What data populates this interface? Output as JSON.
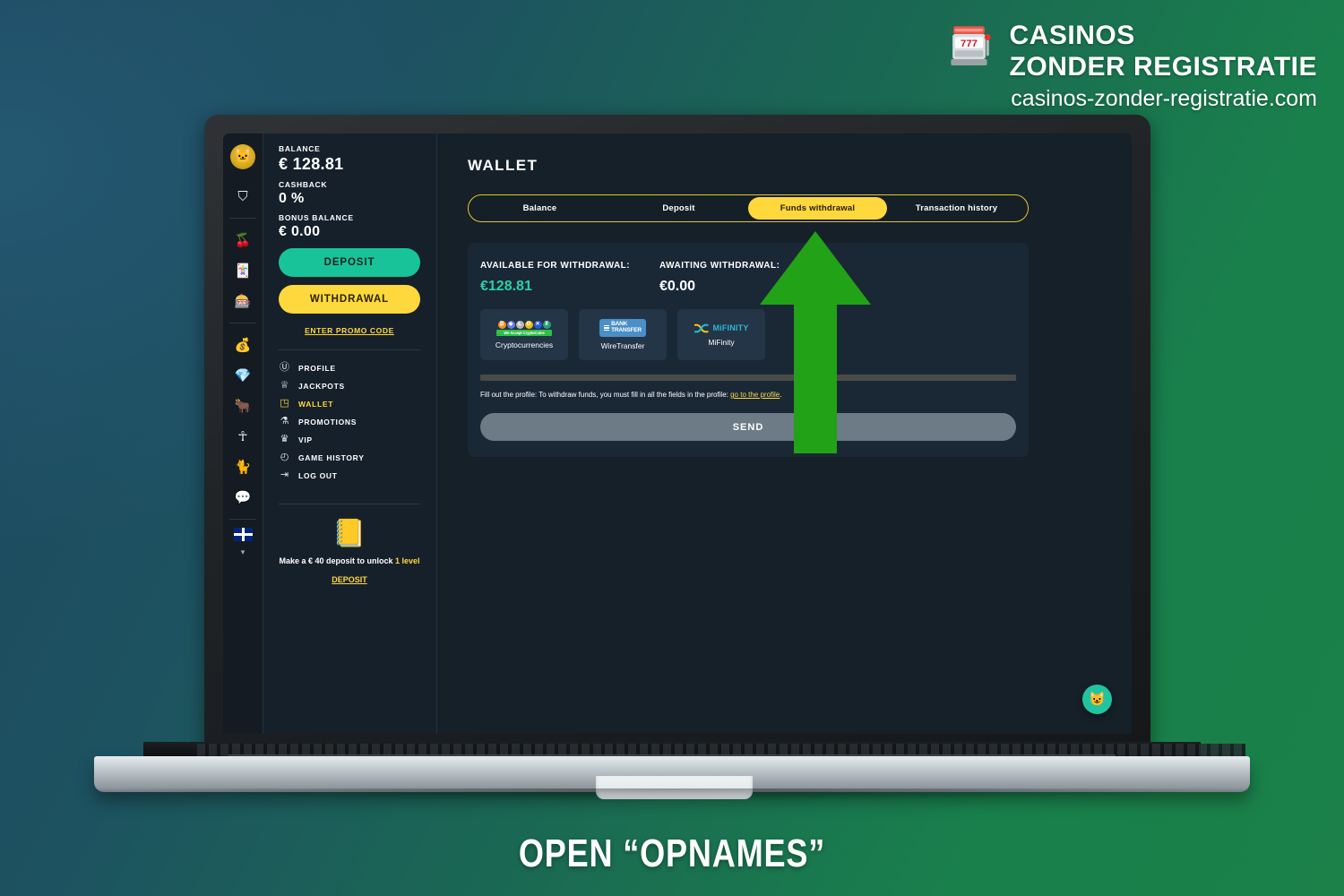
{
  "brand": {
    "line1": "CASINOS",
    "line2": "ZONDER REGISTRATIE",
    "url": "casinos-zonder-registratie.com",
    "logo_icon": "slot-machine-777-icon"
  },
  "caption": "OPEN “OPNAMES”",
  "colors": {
    "accent_yellow": "#ffd83d",
    "accent_teal": "#18c39a",
    "arrow_green": "#22a216",
    "bg_blue": "#1d4760",
    "bg_green": "#1b8149",
    "app_bg": "#152029",
    "panel_bg": "#16202b",
    "card_bg": "#1a2836"
  },
  "rail": {
    "avatar_icon": "cat-avatar-icon",
    "items": [
      {
        "icon": "user-profile-icon",
        "glyph": "⛉"
      },
      {
        "icon": "cherries-slots-icon",
        "glyph": "🍒"
      },
      {
        "icon": "playing-cards-icon",
        "glyph": "🃏"
      },
      {
        "icon": "slot-machine-icon",
        "glyph": "🎰"
      },
      {
        "icon": "gold-bars-icon",
        "glyph": "💰"
      },
      {
        "icon": "emerald-gem-icon",
        "glyph": "💎"
      },
      {
        "icon": "golden-bull-icon",
        "glyph": "🐂"
      },
      {
        "icon": "ankh-icon",
        "glyph": "☥"
      },
      {
        "icon": "cat-medallion-icon",
        "glyph": "🐈"
      },
      {
        "icon": "speech-bubble-icon",
        "glyph": "💬"
      }
    ],
    "language_flag": "uk-flag-icon",
    "chevron": "▾"
  },
  "account": {
    "balance_label": "BALANCE",
    "balance_value": "€ 128.81",
    "cashback_label": "CASHBACK",
    "cashback_value": "0 %",
    "bonus_label": "BONUS BALANCE",
    "bonus_value": "€ 0.00",
    "deposit_button": "DEPOSIT",
    "withdrawal_button": "WITHDRAWAL",
    "promo_link": "ENTER PROMO CODE",
    "menu": [
      {
        "label": "PROFILE",
        "icon": "user-circle-icon",
        "glyph": "ⓤ",
        "active": false
      },
      {
        "label": "JACKPOTS",
        "icon": "crown-icon",
        "glyph": "♕",
        "active": false
      },
      {
        "label": "WALLET",
        "icon": "wallet-icon",
        "glyph": "◳",
        "active": true
      },
      {
        "label": "PROMOTIONS",
        "icon": "gift-icon",
        "glyph": "⚒",
        "active": false
      },
      {
        "label": "VIP",
        "icon": "vip-crown-icon",
        "glyph": "♛",
        "active": false
      },
      {
        "label": "GAME HISTORY",
        "icon": "clock-history-icon",
        "glyph": "◴",
        "active": false
      },
      {
        "label": "LOG OUT",
        "icon": "logout-icon",
        "glyph": "⇥",
        "active": false
      }
    ],
    "level": {
      "icon": "open-gold-book-icon",
      "text_pre": "Make a € 40 deposit to unlock ",
      "text_num": "1",
      "text_post": " level",
      "deposit_link": "DEPOSIT"
    }
  },
  "wallet": {
    "title": "WALLET",
    "tabs": [
      {
        "label": "Balance",
        "active": false
      },
      {
        "label": "Deposit",
        "active": false
      },
      {
        "label": "Funds withdrawal",
        "active": true
      },
      {
        "label": "Transaction history",
        "active": false
      }
    ],
    "available_label": "AVAILABLE FOR WITHDRAWAL:",
    "available_value": "€128.81",
    "awaiting_label": "AWAITING WITHDRAWAL:",
    "awaiting_value": "€0.00",
    "methods": [
      {
        "name": "Cryptocurrencies",
        "badge": "crypto-coins-badge",
        "strip": "We Accept CryptoCoins"
      },
      {
        "name": "WireTransfer",
        "badge": "bank-transfer-badge",
        "badge_text_1": "BANK",
        "badge_text_2": "TRANSFER"
      },
      {
        "name": "MiFinity",
        "badge": "mifinity-badge",
        "badge_text": "MiFINITY"
      }
    ],
    "notice_text": "Fill out the profile: To withdraw funds, you must fill in all the fields in the profile: ",
    "notice_link": "go to the profile",
    "send_button": "SEND",
    "chat_icon": "cat-chat-bubble-icon"
  }
}
